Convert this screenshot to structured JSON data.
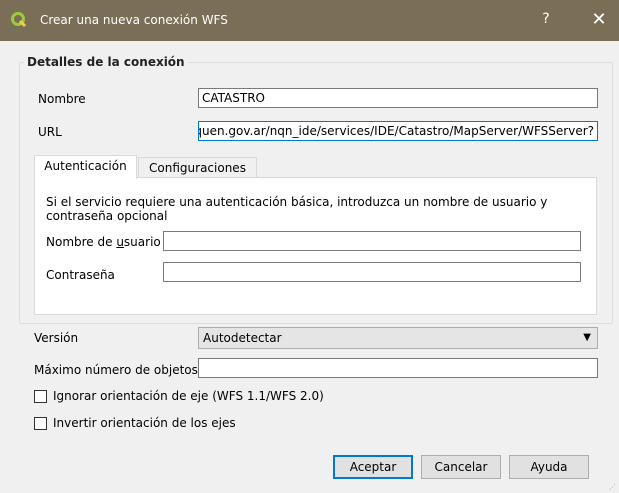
{
  "window": {
    "title": "Crear una nueva conexión WFS",
    "help_label": "?",
    "close_label": "✕",
    "logo_icon": "qgis-logo-icon"
  },
  "group": {
    "title": "Detalles de la conexión"
  },
  "fields": {
    "name_label": "Nombre",
    "name_value": "CATASTRO",
    "url_label": "URL",
    "url_value": "iquen.gov.ar/nqn_ide/services/IDE/Catastro/MapServer/WFSServer?"
  },
  "tabs": [
    {
      "label": "Autenticación",
      "active": true
    },
    {
      "label": "Configuraciones",
      "active": false
    }
  ],
  "auth": {
    "description": "Si el servicio requiere una autenticación básica, introduzca un nombre de usuario y contraseña opcional",
    "username_label_pre": "Nombre de ",
    "username_label_mn": "u",
    "username_label_post": "suario",
    "username_value": "",
    "password_label": "Contraseña",
    "password_value": ""
  },
  "settings": {
    "version_label": "Versión",
    "version_value": "Autodetectar",
    "max_features_label": "Máximo número de objetos",
    "max_features_value": "",
    "ignore_axis_label": "Ignorar orientación de eje (WFS 1.1/WFS 2.0)",
    "ignore_axis_checked": false,
    "invert_axis_label": "Invertir orientación de los ejes",
    "invert_axis_checked": false
  },
  "buttons": {
    "accept": "Aceptar",
    "cancel": "Cancelar",
    "help": "Ayuda"
  },
  "colors": {
    "titlebar": "#7a6f56",
    "focus_accent": "#0078d7"
  }
}
